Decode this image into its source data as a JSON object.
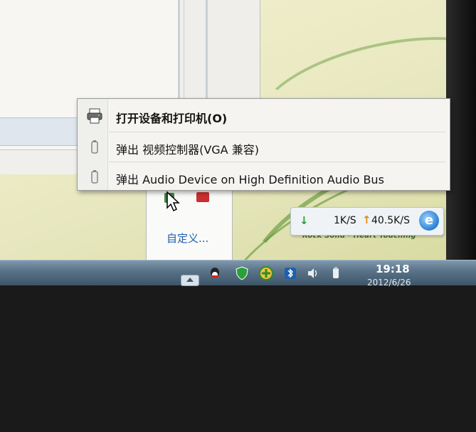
{
  "context_menu": {
    "items": [
      {
        "label": "打开设备和打印机(O)",
        "icon": "printer-icon",
        "bold": true
      },
      {
        "label": "弹出 视频控制器(VGA 兼容)",
        "icon": "usb-device-icon"
      },
      {
        "label": "弹出 Audio Device on High Definition Audio Bus",
        "icon": "usb-device-icon"
      }
    ]
  },
  "tray_panel": {
    "customize_link": "自定义..."
  },
  "net_meter": {
    "down_value": "1K/S",
    "up_value": "40.5K/S",
    "browser_icon": "ie-icon"
  },
  "wallpaper": {
    "tagline": "Rock Solid · Heart Touching"
  },
  "taskbar": {
    "time": "19:18",
    "date": "2012/6/26",
    "tray_icons": [
      "qq-icon",
      "security-shield-icon",
      "plus-icon",
      "bluetooth-icon",
      "volume-icon",
      "usb-icon"
    ]
  },
  "colors": {
    "link": "#1f5fb7",
    "down_arrow": "#2a9a3a",
    "up_arrow": "#e08a1a",
    "taskbar": "#5b7489"
  }
}
